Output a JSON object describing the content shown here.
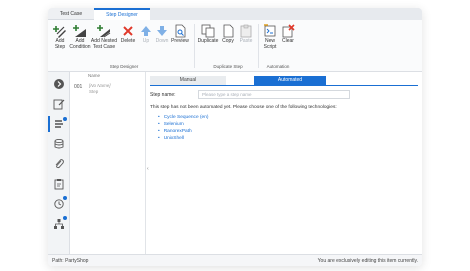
{
  "tabs": [
    {
      "label": "Test Case"
    },
    {
      "label": "Step Designer"
    }
  ],
  "ribbon": {
    "buttons": [
      {
        "label": "Add\nStep",
        "icon": "add-step-icon"
      },
      {
        "label": "Add\nCondition",
        "icon": "add-condition-icon"
      },
      {
        "label": "Add Nested\nTest Case",
        "icon": "add-nested-icon"
      },
      {
        "label": "Delete",
        "icon": "delete-icon"
      },
      {
        "label": "Up",
        "icon": "up-arrow-icon"
      },
      {
        "label": "Down",
        "icon": "down-arrow-icon"
      },
      {
        "label": "Preview",
        "icon": "preview-icon"
      },
      {
        "label": "Duplicate",
        "icon": "duplicate-icon"
      },
      {
        "label": "Copy",
        "icon": "copy-icon"
      },
      {
        "label": "Paste",
        "icon": "paste-icon"
      },
      {
        "label": "New\nScript",
        "icon": "new-script-icon"
      },
      {
        "label": "Clear",
        "icon": "clear-icon"
      }
    ],
    "groups": {
      "step_designer": "Step Designer",
      "duplicate_step": "Duplicate Step",
      "automation": "Automation"
    }
  },
  "steplist": {
    "col_header": "Name",
    "step_number": "001",
    "step_name": "[No Name]",
    "step_type": "Step"
  },
  "detail": {
    "tab_manual": "Manual",
    "tab_automated": "Automated",
    "step_name_label": "Step name:",
    "step_name_placeholder": "Please type a step name",
    "info": "This step has not been automated yet. Please choose one of the following technologies:",
    "technologies": [
      "Cycle Sequence (en)",
      "Selenium",
      "RanorexPath",
      "UnixShell"
    ]
  },
  "status": {
    "path": "Path: PartyShop",
    "message": "You are exclusively editing this item currently."
  },
  "colors": {
    "accent": "#1a6fd3",
    "delete": "#e0392b",
    "add": "#2e7d32"
  }
}
